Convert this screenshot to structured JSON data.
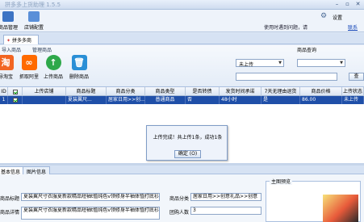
{
  "window": {
    "title": "拼多多上货助理 1.5.5",
    "btn_min": "–",
    "btn_max": "▫",
    "btn_close": "✕"
  },
  "menubar": {
    "tools": [
      {
        "label": "商品管理",
        "icon": "product-manage-icon"
      },
      {
        "label": "店铺配置",
        "icon": "shop-config-icon"
      }
    ],
    "settings_label": "设置",
    "help_text": "使用时遇到问题，请",
    "help_link": "联系"
  },
  "tab": {
    "label": "拼多多商品"
  },
  "ribbon": {
    "group_fetch": "导入商品",
    "group_manage": "管理商品",
    "group_query": "商品查询",
    "buttons": [
      {
        "label": "导淘宝",
        "icon": "taobao-icon",
        "color": "#f26522"
      },
      {
        "label": "抓取阿里",
        "icon": "alibaba-icon",
        "color": "#ff6a00"
      },
      {
        "label": "上传商品",
        "icon": "upload-icon",
        "color": "#2ea84a"
      },
      {
        "label": "删除商品",
        "icon": "delete-icon",
        "color": "#2a8fd6"
      }
    ],
    "status_select": "未上传",
    "status_select_2": "",
    "query_button": "查"
  },
  "grid": {
    "columns": [
      "ID",
      "",
      "上传店铺",
      "商品标题",
      "商品分类",
      "商品类型",
      "是否转债",
      "发货时间承诺",
      "7天无理由退货",
      "商品价格",
      "上传状态"
    ],
    "rows": [
      [
        "1",
        "",
        "",
        "夏装翼尺...",
        "居家日用>>创...",
        "普通商品",
        "否",
        "48小时",
        "是",
        "86.00",
        "未上传"
      ]
    ]
  },
  "dialog": {
    "message": "上传完成！共上传1条，成功1条",
    "ok_label": "确定 (O)"
  },
  "bottom_tabs": [
    "基本信息",
    "图片信息"
  ],
  "detail": {
    "title_label": "商品标题",
    "title_value": "夏装翼尺寸衣服夏新款精品短袖t恤纯色v领修身半袖体恤打底衫男士衣",
    "desc_label": "商品详情",
    "desc_value": "夏装翼尺寸衣服夏新款精品短袖t恤纯色v领修身半袖体恤打底衫男士衣",
    "category_label": "商品分类",
    "category_value": "居家日用>>创意礼品>>创意",
    "group_label": "团购人数",
    "group_value": "3",
    "image_label": "主图预览"
  }
}
